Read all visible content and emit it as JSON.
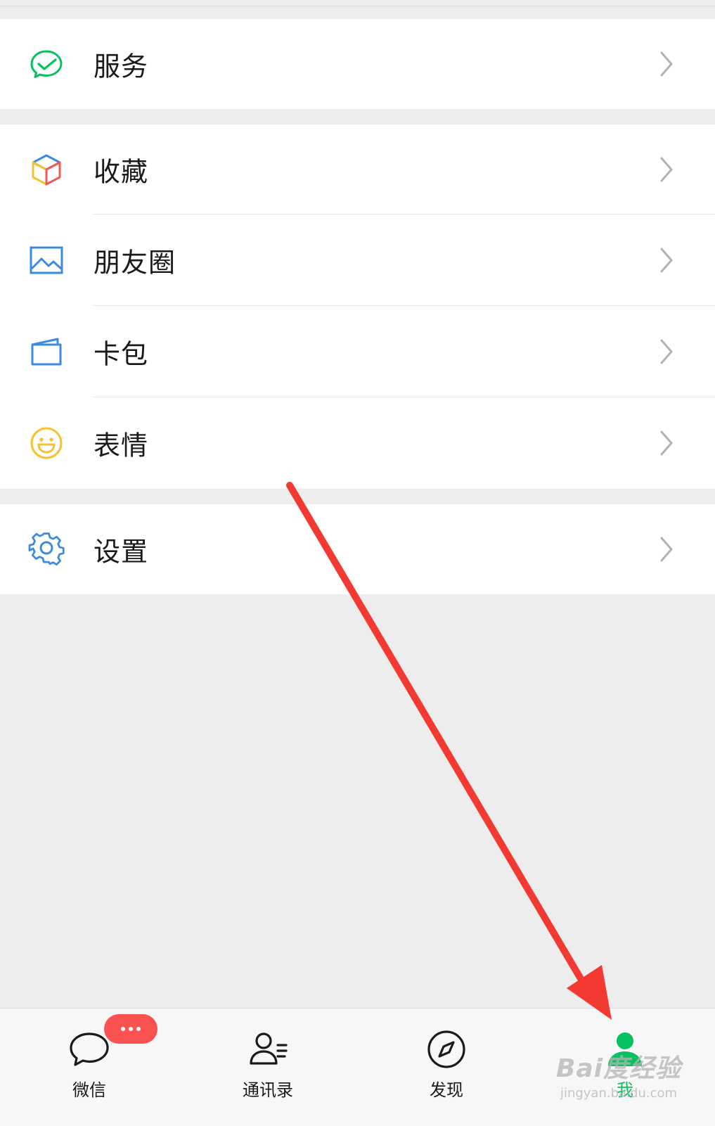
{
  "menu": {
    "service": "服务",
    "favorites": "收藏",
    "moments": "朋友圈",
    "cards": "卡包",
    "stickers": "表情",
    "settings": "设置"
  },
  "tabbar": {
    "chats": "微信",
    "contacts": "通讯录",
    "discover": "发现",
    "me": "我"
  },
  "watermark": {
    "logo": "Bai度经验",
    "url": "jingyan.baidu.com"
  },
  "colors": {
    "accent_green": "#07c160",
    "badge_red": "#fa5151",
    "arrow_red": "#f23a33",
    "icon_blue": "#3d8bdc",
    "icon_yellow": "#f5c130"
  },
  "icons": {
    "service": "check-bubble-icon",
    "favorites": "cube-icon",
    "moments": "picture-icon",
    "cards": "card-wallet-icon",
    "stickers": "smile-icon",
    "settings": "gear-icon",
    "chats": "chat-bubble-icon",
    "contacts": "person-list-icon",
    "discover": "compass-icon",
    "me": "person-icon"
  }
}
